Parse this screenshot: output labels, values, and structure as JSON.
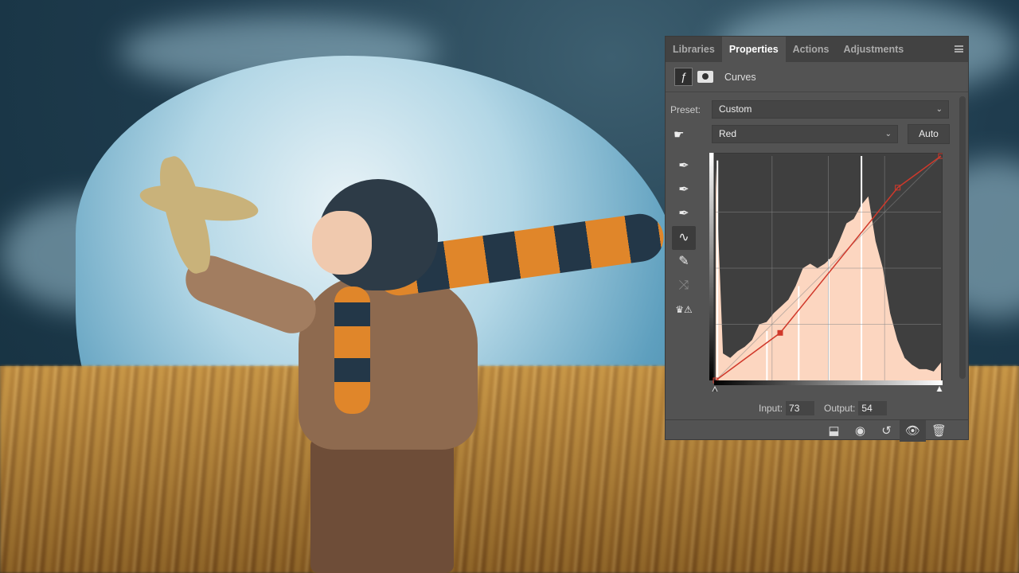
{
  "panel": {
    "tabs": [
      "Libraries",
      "Properties",
      "Actions",
      "Adjustments"
    ],
    "active_tab": "Properties",
    "adjustment_title": "Curves",
    "preset_label": "Preset:",
    "preset_value": "Custom",
    "channel_value": "Red",
    "auto_label": "Auto",
    "input_label": "Input:",
    "input_value": "73",
    "output_label": "Output:",
    "output_value": "54",
    "curve_color": "#d0392b",
    "histogram_color": "#fcd6c0",
    "curve_points": [
      [
        0,
        0
      ],
      [
        73,
        54
      ],
      [
        206,
        219
      ],
      [
        255,
        255
      ]
    ],
    "histogram": [
      0.95,
      0.12,
      0.1,
      0.13,
      0.15,
      0.18,
      0.25,
      0.26,
      0.3,
      0.33,
      0.36,
      0.42,
      0.5,
      0.52,
      0.5,
      0.52,
      0.55,
      0.62,
      0.7,
      0.72,
      0.78,
      0.82,
      0.62,
      0.5,
      0.3,
      0.18,
      0.1,
      0.07,
      0.05,
      0.05,
      0.04,
      0.08
    ],
    "histogram_spikes": [
      [
        2,
        0.98
      ],
      [
        58,
        0.22
      ],
      [
        94,
        0.42
      ],
      [
        128,
        0.54
      ],
      [
        165,
        1.0
      ]
    ]
  }
}
